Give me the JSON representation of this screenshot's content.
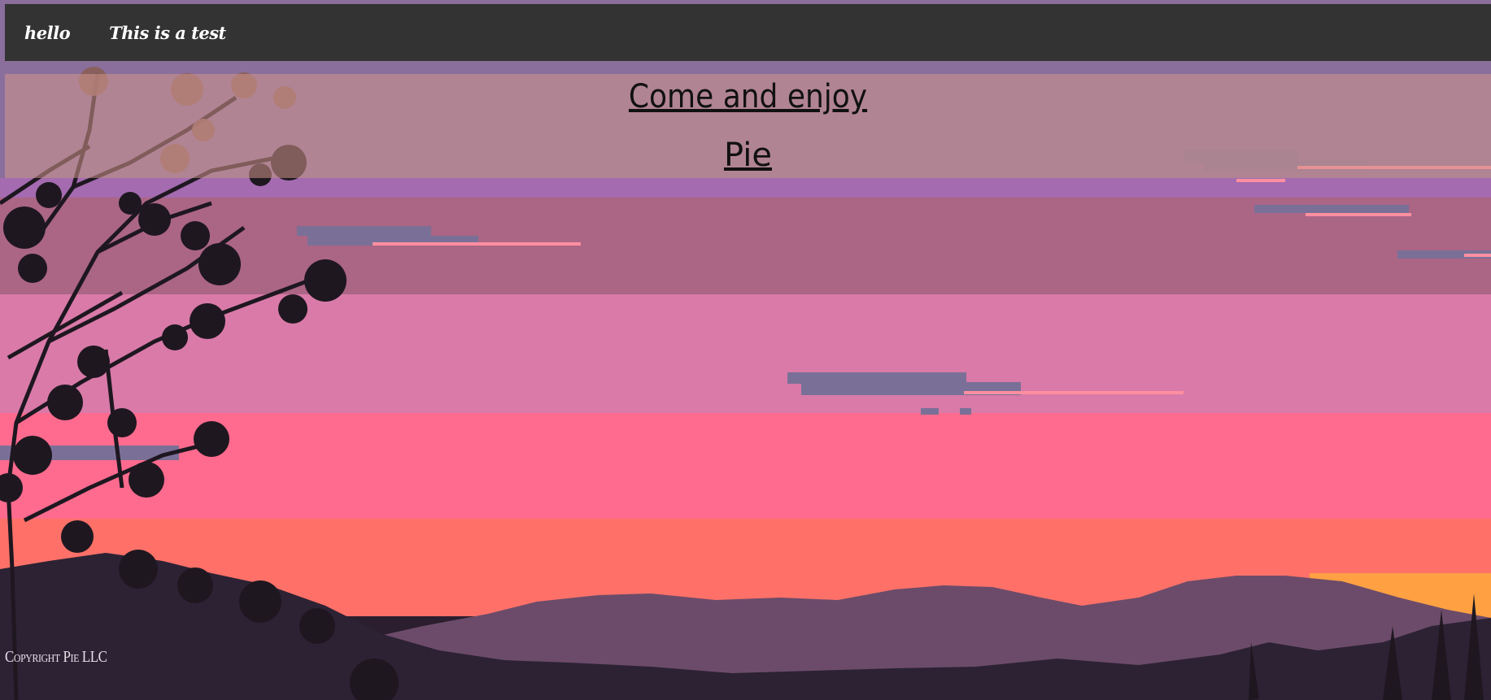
{
  "nav": {
    "links": [
      {
        "label": "hello"
      },
      {
        "label": "This is a test"
      }
    ]
  },
  "hero": {
    "title": "Come and enjoy",
    "subtitle": "Pie"
  },
  "footer": {
    "copyright": "Copyright Pie LLC"
  },
  "colors": {
    "navbar": "#333333",
    "sky_top": "#a46bb0",
    "sky_mauve": "#ab6585",
    "sky_pink": "#d97aa8",
    "sky_hot_pink": "#ff6b8e",
    "sky_coral": "#ff7168",
    "sun_orange": "#ffa142",
    "hills_far": "#6c4b6a",
    "hills_near": "#2c2234",
    "tree_silhouette": "#1e1720"
  }
}
